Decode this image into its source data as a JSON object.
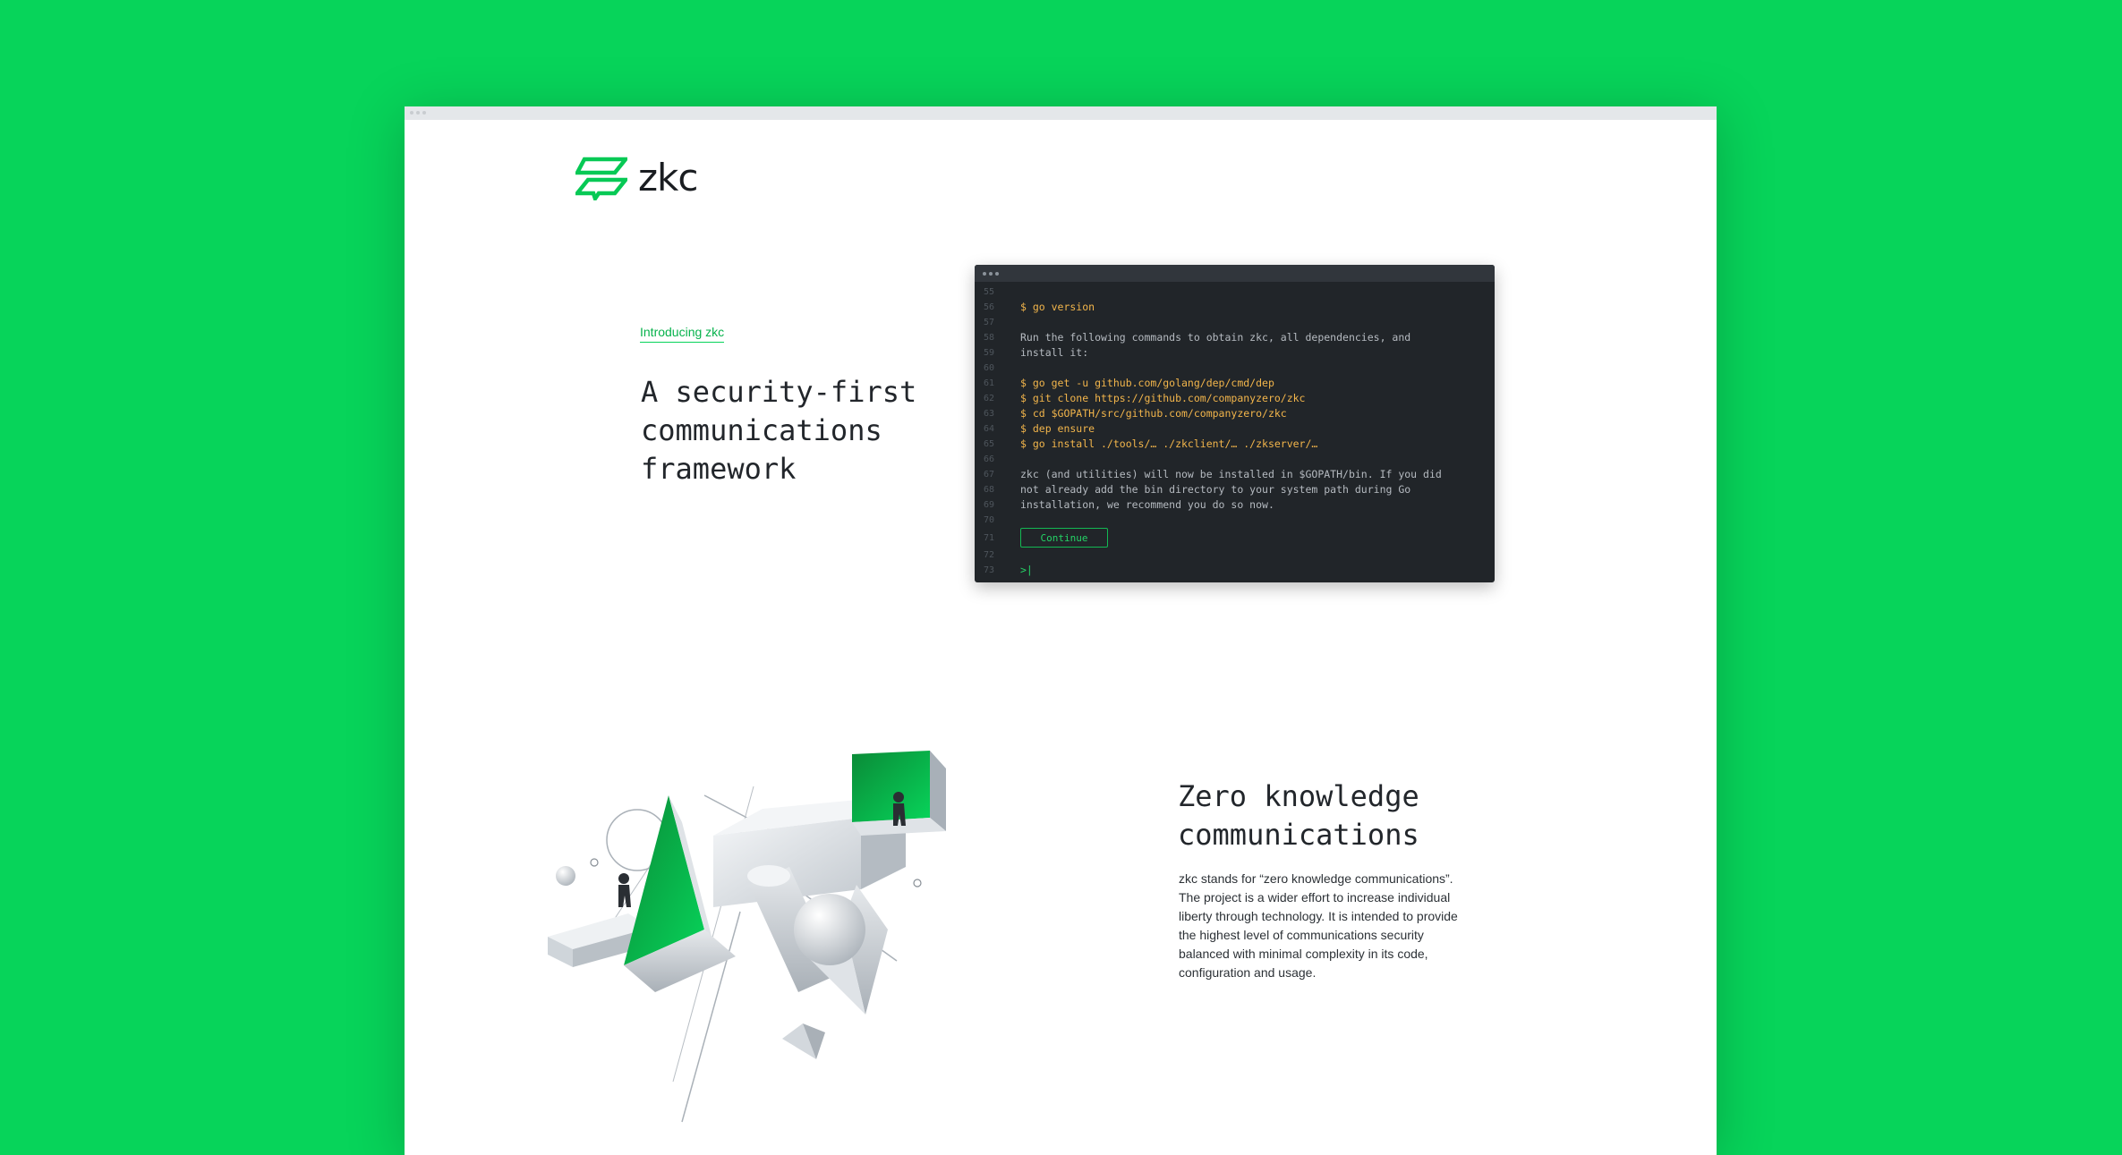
{
  "brand": {
    "name": "zkc",
    "accent": "#07d45a",
    "background": "#07d45a"
  },
  "hero": {
    "intro_link": "Introducing zkc",
    "title": "A security-first\ncommunications\nframework"
  },
  "terminal": {
    "lines": [
      {
        "n": "55",
        "text": "",
        "kind": "text"
      },
      {
        "n": "56",
        "text": "$ go version",
        "kind": "cmd"
      },
      {
        "n": "57",
        "text": "",
        "kind": "text"
      },
      {
        "n": "58",
        "text": "Run the following commands to obtain zkc, all dependencies, and",
        "kind": "text"
      },
      {
        "n": "59",
        "text": "install it:",
        "kind": "text"
      },
      {
        "n": "60",
        "text": "",
        "kind": "text"
      },
      {
        "n": "61",
        "text": "$ go get -u github.com/golang/dep/cmd/dep",
        "kind": "cmd"
      },
      {
        "n": "62",
        "text": "$ git clone https://github.com/companyzero/zkc",
        "kind": "cmd"
      },
      {
        "n": "63",
        "text": "$ cd $GOPATH/src/github.com/companyzero/zkc",
        "kind": "cmd"
      },
      {
        "n": "64",
        "text": "$ dep ensure",
        "kind": "cmd"
      },
      {
        "n": "65",
        "text": "$ go install ./tools/… ./zkclient/… ./zkserver/…",
        "kind": "cmd"
      },
      {
        "n": "66",
        "text": "",
        "kind": "text"
      },
      {
        "n": "67",
        "text": "zkc (and utilities) will now be installed in $GOPATH/bin. If you did",
        "kind": "text"
      },
      {
        "n": "68",
        "text": "not already add the bin directory to your system path during Go",
        "kind": "text"
      },
      {
        "n": "69",
        "text": "installation, we recommend you do so now.",
        "kind": "text"
      },
      {
        "n": "70",
        "text": "",
        "kind": "text"
      }
    ],
    "button_line_number": "71",
    "continue_label": "Continue",
    "after_lines": [
      {
        "n": "72",
        "text": "",
        "kind": "text"
      },
      {
        "n": "73",
        "text": ">|",
        "kind": "prompt"
      }
    ]
  },
  "section": {
    "title": "Zero knowledge\ncommunications",
    "body": "zkc stands for “zero knowledge communications”. The project is a wider effort to increase individual liberty through technology. It is intended to provide the highest level of communications security balanced with minimal complexity in its code, configuration and usage."
  }
}
